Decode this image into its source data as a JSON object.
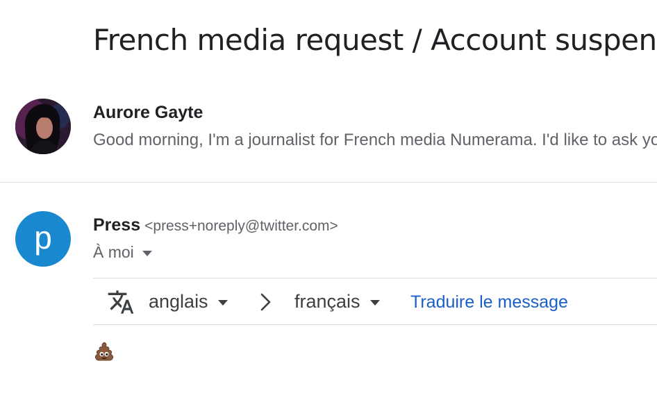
{
  "thread": {
    "subject": "French media request / Account suspended"
  },
  "messages": [
    {
      "sender": "Aurore Gayte",
      "snippet": "Good morning, I'm a journalist for French media Numerama. I'd like to ask you about",
      "avatar": "photo"
    },
    {
      "sender": "Press",
      "email": "<press+noreply@twitter.com>",
      "to_label": "À moi",
      "avatar_letter": "p",
      "avatar_color": "#1a88cf",
      "translate": {
        "icon": "translate-icon",
        "from_lang": "anglais",
        "to_lang": "français",
        "action_label": "Traduire le message",
        "link_color": "#1a5fc8"
      },
      "body_emoji": "pile-of-poo"
    }
  ]
}
